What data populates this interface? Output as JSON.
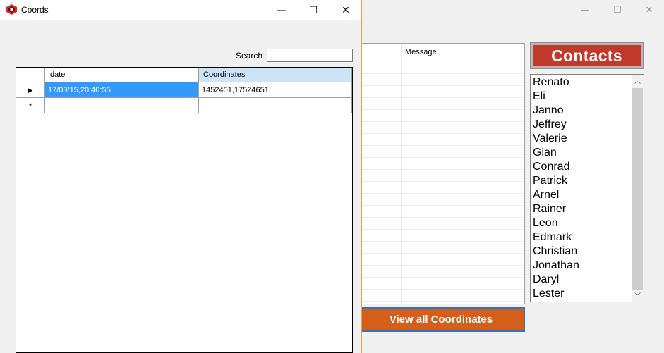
{
  "main_window": {
    "controls": {
      "minimize": "—",
      "maximize": "☐",
      "close": "✕"
    },
    "message_grid": {
      "column_header": "Message"
    },
    "contacts_button_label": "Contacts",
    "contacts": [
      "Renato",
      "Eli",
      "Janno",
      "Jeffrey",
      "Valerie",
      "Gian",
      "Conrad",
      "Patrick",
      "Arnel",
      "Rainer",
      "Leon",
      "Edmark",
      "Christian",
      "Jonathan",
      "Daryl",
      "Lester"
    ],
    "view_coords_button_label": "View all Coordinates",
    "colors": {
      "contacts_button": "#c0392b",
      "view_coords_button": "#d35f1a"
    }
  },
  "coords_window": {
    "title": "Coords",
    "icon": "app-icon",
    "controls": {
      "minimize": "—",
      "maximize": "☐",
      "close": "✕"
    },
    "search": {
      "label": "Search",
      "value": ""
    },
    "grid": {
      "columns": [
        "date",
        "Coordinates"
      ],
      "rows": [
        {
          "marker": "▶",
          "date": "17/03/15,20:40:55",
          "coordinates": "1452451,17524651"
        }
      ],
      "new_row_marker": "*"
    },
    "colors": {
      "selected_cell": "#3399ff",
      "selected_header": "#cce4f7"
    }
  }
}
